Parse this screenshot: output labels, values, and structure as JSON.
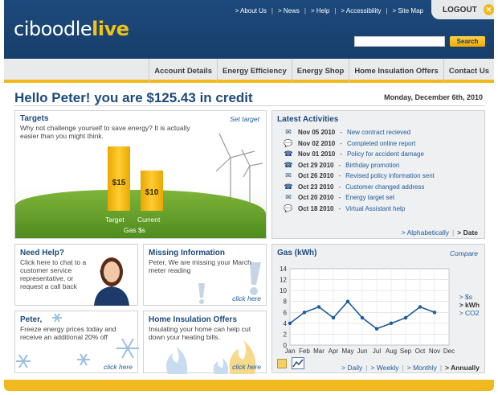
{
  "brand": {
    "name": "ciboodle",
    "suffix": "live"
  },
  "top_links": [
    "> About Us",
    "> News",
    "> Help",
    "> Accessibility",
    "> Site Map"
  ],
  "logout": {
    "label": "LOGOUT",
    "icon": "close-icon"
  },
  "search": {
    "placeholder": "",
    "button": "Search"
  },
  "nav": [
    "Account Details",
    "Energy Efficiency",
    "Energy Shop",
    "Home Insulation Offers",
    "Contact Us"
  ],
  "greeting": "Hello Peter! you are $125.43 in credit",
  "date": "Monday, December 6th, 2010",
  "targets": {
    "title": "Targets",
    "text": "Why not challenge yourself to save energy? It is actually easier than you might think.",
    "set_target": "Set target",
    "target_value": "$15",
    "current_value": "$10",
    "target_label": "Target",
    "current_label": "Current",
    "caption": "Gas $s",
    "target_amount": 15,
    "current_amount": 10
  },
  "activities": {
    "title": "Latest Activities",
    "items": [
      {
        "icon": "envelope-icon",
        "date": "Nov 05 2010",
        "text": "New contract recieved"
      },
      {
        "icon": "chat-icon",
        "date": "Nov 02 2010",
        "text": "Completed online report"
      },
      {
        "icon": "phone-icon",
        "date": "Nov 01 2010",
        "text": "Policy for accident damage"
      },
      {
        "icon": "phone-icon",
        "date": "Oct 29 2010",
        "text": "Birthday promotion"
      },
      {
        "icon": "envelope-icon",
        "date": "Oct 26 2010",
        "text": "Revised policy information sent"
      },
      {
        "icon": "phone-icon",
        "date": "Oct 23 2010",
        "text": "Customer changed address"
      },
      {
        "icon": "envelope-icon",
        "date": "Oct 20 2010",
        "text": "Energy target set"
      },
      {
        "icon": "chat-icon",
        "date": "Oct 18 2010",
        "text": "Virtual Assistant help"
      }
    ],
    "sort_alpha": "> Alphabetically",
    "sort_sep": "|",
    "sort_date": "> Date"
  },
  "help": {
    "title": "Need Help?",
    "text": "Click here to chat to a customer service representative, or request a call back"
  },
  "missing": {
    "title": "Missing Information",
    "text": "Peter, We are missing your March meter reading",
    "link": "click here"
  },
  "promo": {
    "title": "Peter,",
    "text": "Freeze energy prices today and receive an additional 20% off",
    "link": "click here"
  },
  "insulation": {
    "title": "Home Insulation Offers",
    "text": "Insulating your home can help cut down your heating bills.",
    "link": "click here"
  },
  "gas_chart": {
    "title": "Gas (kWh)",
    "compare": "Compare",
    "legend": [
      "> $s",
      "> kWh",
      "> CO2"
    ],
    "periods": [
      "> Daily",
      "> Weekly",
      "> Monthly",
      "> Annually"
    ]
  },
  "chart_data": {
    "type": "line",
    "title": "Gas (kWh)",
    "categories": [
      "Jan",
      "Feb",
      "Mar",
      "Apr",
      "May",
      "Jun",
      "Jul",
      "Aug",
      "Sep",
      "Oct",
      "Nov",
      "Dec"
    ],
    "series": [
      {
        "values": [
          4,
          6,
          7,
          5,
          8,
          5,
          3,
          4,
          5,
          7,
          6
        ]
      }
    ],
    "ylim": [
      0,
      14
    ],
    "yticks": [
      0,
      2,
      4,
      6,
      8,
      10,
      12,
      14
    ],
    "grid": true,
    "line_color": "#1d5a9a"
  },
  "colors": {
    "brand_blue": "#1d4a7c",
    "accent_yellow": "#f2b81f",
    "grass_green": "#5f9a26"
  }
}
